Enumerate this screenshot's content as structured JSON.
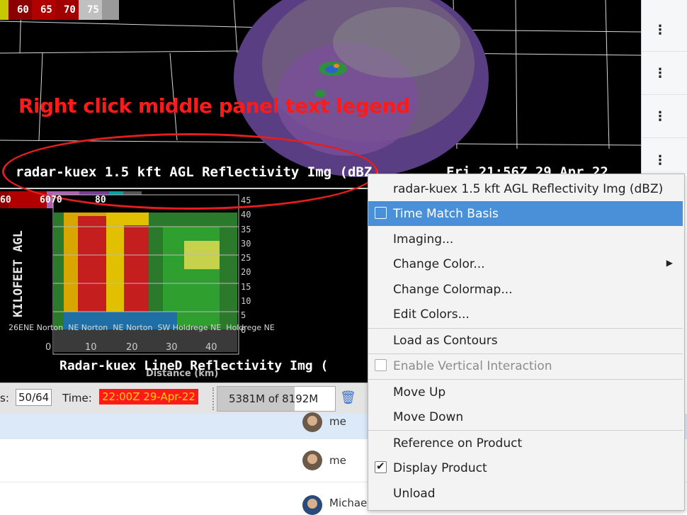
{
  "colorbar_top": [
    "60",
    "65",
    "70",
    "75"
  ],
  "annotation": "Right click middle panel text legend",
  "legend_text": "radar-kuex 1.5 kft AGL Reflectivity Img (dBZ)",
  "legend_date": "Fri 21:56Z 29 Apr 22",
  "colorbar_mid": [
    "60",
    "60",
    "70",
    "80"
  ],
  "xsection": {
    "title": "Radar-kuex LineD Reflectivity Img (",
    "ylabel": "KILOFEET AGL",
    "xlabel": "Distance (km)",
    "location_labels": "26ENE Norton  NE Norton  NE Norton  SW Holdrege NE  Holdrege NE",
    "y_ticks": [
      "45",
      "40",
      "35",
      "30",
      "25",
      "20",
      "15",
      "10",
      "5",
      "0"
    ],
    "x_ticks": [
      "0",
      "10",
      "20",
      "30",
      "40"
    ]
  },
  "statusbar": {
    "frames_label": "s:",
    "frames_value": "50/64",
    "time_label": "Time:",
    "time_value": "22:00Z 29-Apr-22",
    "memory": "5381M of 8192M",
    "memory_fraction": 0.657
  },
  "chat_rows": [
    {
      "name": "me"
    },
    {
      "name": "me"
    },
    {
      "name": "Michae"
    }
  ],
  "context_menu": {
    "title": "radar-kuex 1.5 kft AGL Reflectivity Img (dBZ)",
    "time_match": "Time Match Basis",
    "imaging": "Imaging...",
    "change_color": "Change Color...",
    "change_colormap": "Change Colormap...",
    "edit_colors": "Edit Colors...",
    "load_contours": "Load as Contours",
    "enable_vertical": "Enable Vertical Interaction",
    "move_up": "Move Up",
    "move_down": "Move Down",
    "reference_product": "Reference on Product",
    "display_product": "Display Product",
    "unload": "Unload"
  },
  "colors": {
    "annotation": "#ff1a1a",
    "menu_highlight": "#4a90d9",
    "time_bg": "#ff1a1a",
    "time_fg": "#ffd400"
  }
}
